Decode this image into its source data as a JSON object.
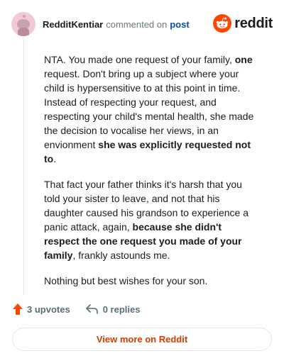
{
  "header": {
    "username": "RedditKentiar",
    "action_text": "commented on",
    "post_link": "post",
    "brand_name": "reddit"
  },
  "comment": {
    "paragraphs": [
      {
        "segments": [
          {
            "text": "NTA. You made one request of your family, ",
            "bold": false
          },
          {
            "text": "one",
            "bold": true
          },
          {
            "text": " request. Don't bring up a subject where your child is hypersensitive to at this point in time. Instead of respecting your request, and respecting your child's mental health, she made the decision to vocalise her views, in an envionment ",
            "bold": false
          },
          {
            "text": "she was explicitly requested not to",
            "bold": true
          },
          {
            "text": ".",
            "bold": false
          }
        ]
      },
      {
        "segments": [
          {
            "text": "That fact your father thinks it's harsh that you told your sister to leave, and not that his daughter caused his grandson to experience a panic attack, again, ",
            "bold": false
          },
          {
            "text": "because she didn't respect the one request you made of your family",
            "bold": true
          },
          {
            "text": ", frankly astounds me.",
            "bold": false
          }
        ]
      },
      {
        "segments": [
          {
            "text": "Nothing but best wishes for your son.",
            "bold": false
          }
        ]
      }
    ]
  },
  "actions": {
    "upvotes": "3 upvotes",
    "replies": "0 replies"
  },
  "footer": {
    "view_button": "View more on Reddit"
  },
  "colors": {
    "accent": "#d93a00",
    "upvote": "#ff4500",
    "link": "#0a4f9e"
  },
  "icons": [
    "avatar",
    "reddit-logo-icon",
    "upvote-arrow-icon",
    "reply-arrow-icon"
  ]
}
